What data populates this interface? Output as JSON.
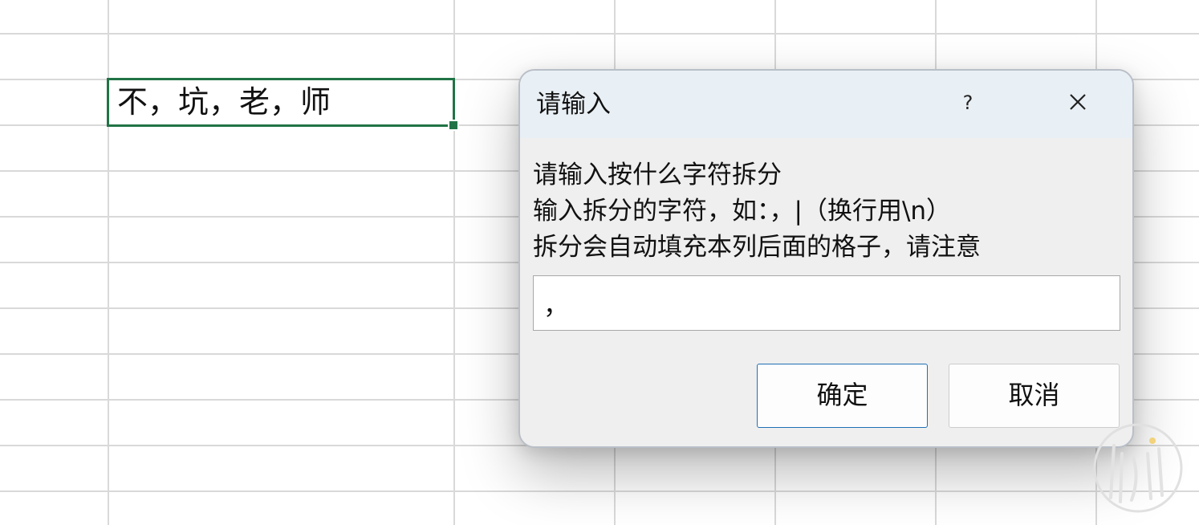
{
  "sheet": {
    "active_cell_value": "不，坑，老，师"
  },
  "dialog": {
    "title": "请输入",
    "help_label": "?",
    "prompt_lines": [
      "请输入按什么字符拆分",
      "输入拆分的字符，如：，|（换行用\\n）",
      "拆分会自动填充本列后面的格子，请注意"
    ],
    "input_value": "，",
    "ok_label": "确定",
    "cancel_label": "取消"
  },
  "colors": {
    "selection_border": "#217346",
    "dialog_titlebar": "#e9f0f5",
    "dialog_body": "#efefef",
    "default_button_border": "#1f6fb5"
  },
  "icons": {
    "close": "close-icon",
    "help": "help-icon",
    "watermark": "watermark-logo"
  }
}
